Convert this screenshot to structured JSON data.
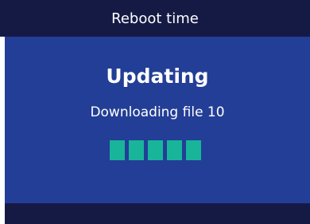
{
  "titlebar": {
    "title": "Reboot time"
  },
  "update": {
    "heading": "Updating",
    "message": "Downloading file 10",
    "progress": {
      "filled_segments": 5,
      "color": "#18b59a"
    }
  },
  "colors": {
    "titlebar_bg": "#151a45",
    "content_bg": "#233e96",
    "text": "#ffffff"
  }
}
